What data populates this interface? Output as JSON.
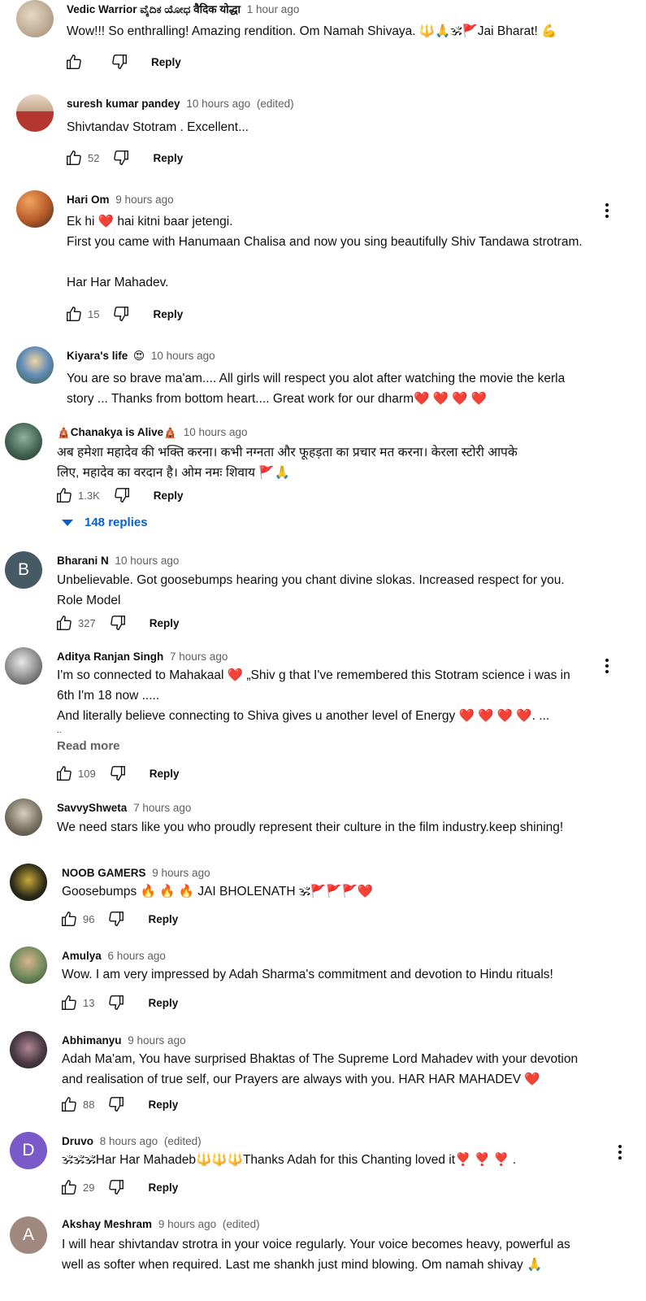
{
  "comments": [
    {
      "author": "Vedic Warrior ವೈದಿಕ ಯೋಧ वैदिक योद्धा",
      "time": "1 hour ago",
      "edited": "",
      "lines": [
        "Wow!!! So enthralling! Amazing rendition. Om Namah Shivaya. 🔱🙏🕉🚩Jai Bharat! 💪"
      ],
      "likes": "",
      "reply_label": "Reply",
      "avatar_color": "#b9a48c"
    },
    {
      "author": "suresh kumar pandey",
      "time": "10 hours ago",
      "edited": "(edited)",
      "lines": [
        "Shivtandav Stotram  . Excellent..."
      ],
      "likes": "52",
      "reply_label": "Reply",
      "avatar_color": "#b3362f"
    },
    {
      "author": "Hari Om",
      "time": "9 hours ago",
      "edited": "",
      "lines": [
        "Ek hi ❤️ hai kitni baar jetengi.",
        "First you came with Hanumaan Chalisa and now you sing beautifully Shiv Tandawa strotram.",
        "",
        "Har Har Mahadev."
      ],
      "likes": "15",
      "reply_label": "Reply",
      "avatar_color": "#c9783a"
    },
    {
      "author": "Kiyara's life",
      "author_emoji": "😍",
      "time": "10 hours ago",
      "edited": "",
      "lines": [
        "You are so brave ma'am.... All girls will  respect you alot after watching the movie the kerla",
        "story  ... Thanks from bottom heart.... Great work for our dharm❤️ ❤️ ❤️ ❤️"
      ],
      "likes": "",
      "reply_label": "",
      "avatar_color": "#7d9a6a"
    },
    {
      "author": "🛕Chanakya is Alive🛕",
      "time": "10 hours ago",
      "edited": "",
      "lines": [
        "अब हमेशा महादेव की भक्ति करना। कभी नग्नता और फूहड़ता का प्रचार मत करना। केरला स्टोरी आपके",
        "लिए, महादेव का वरदान है। ओम नमः शिवाय 🚩🙏"
      ],
      "likes": "1.3K",
      "reply_label": "Reply",
      "replies_label": "148 replies",
      "avatar_color": "#4d6b5a"
    },
    {
      "author": "Bharani N",
      "time": "10 hours ago",
      "edited": "",
      "lines": [
        "Unbelievable. Got goosebumps hearing you chant divine slokas. Increased respect for you.",
        "Role Model"
      ],
      "likes": "327",
      "reply_label": "Reply",
      "avatar_letter": "B",
      "avatar_color": "#455a64"
    },
    {
      "author": "Aditya Ranjan Singh",
      "time": "7 hours ago",
      "edited": "",
      "lines": [
        "I'm so connected to Mahakaal ❤️ „Shiv g that I've remembered this Stotram science i was in",
        "6th I'm 18 now .....",
        "And literally believe connecting to Shiva gives u another level of Energy ❤️ ❤️ ❤️ ❤️. ...",
        ".."
      ],
      "read_more": "Read more",
      "likes": "109",
      "reply_label": "Reply",
      "avatar_color": "#8a8a8a"
    },
    {
      "author": "SavvyShweta",
      "time": "7 hours ago",
      "edited": "",
      "lines": [
        "We need stars like you who proudly represent their culture in the film industry.keep shining!"
      ],
      "likes": "",
      "reply_label": "",
      "avatar_color": "#6b6b60"
    },
    {
      "author": "NOOB GAMERS",
      "time": "9 hours ago",
      "edited": "",
      "lines": [
        "Goosebumps 🔥 🔥 🔥  JAI BHOLENATH 🕉🚩🚩🚩❤️"
      ],
      "likes": "96",
      "reply_label": "Reply",
      "avatar_color": "#1b1b1b"
    },
    {
      "author": "Amulya",
      "time": "6 hours ago",
      "edited": "",
      "lines": [
        "Wow. I am very impressed by Adah Sharma's commitment and devotion to Hindu rituals!"
      ],
      "likes": "13",
      "reply_label": "Reply",
      "avatar_color": "#6f8a5b"
    },
    {
      "author": "Abhimanyu",
      "time": "9 hours ago",
      "edited": "",
      "lines": [
        "Adah Ma'am, You have  surprised Bhaktas of The Supreme Lord Mahadev with your devotion",
        "and realisation of true self, our Prayers are always with you.  HAR HAR MAHADEV ❤️"
      ],
      "likes": "88",
      "reply_label": "Reply",
      "avatar_color": "#4a3a44"
    },
    {
      "author": "Druvo",
      "time": "8 hours ago",
      "edited": "(edited)",
      "lines": [
        "🕉🕉🕉Har Har Mahadeb🔱🔱🔱Thanks Adah for this Chanting loved it❣️ ❣️ ❣️ ."
      ],
      "likes": "29",
      "reply_label": "Reply",
      "avatar_letter": "D",
      "avatar_color": "#7a5ac8"
    },
    {
      "author": "Akshay Meshram",
      "time": "9 hours ago",
      "edited": "(edited)",
      "lines": [
        "I will hear shivtandav strotra in your voice regularly. Your voice becomes heavy, powerful as",
        "well as softer when required. Last me shankh just mind blowing. Om namah shivay 🙏"
      ],
      "likes": "",
      "reply_label": "",
      "avatar_letter": "A",
      "avatar_color": "#a1887f"
    }
  ]
}
